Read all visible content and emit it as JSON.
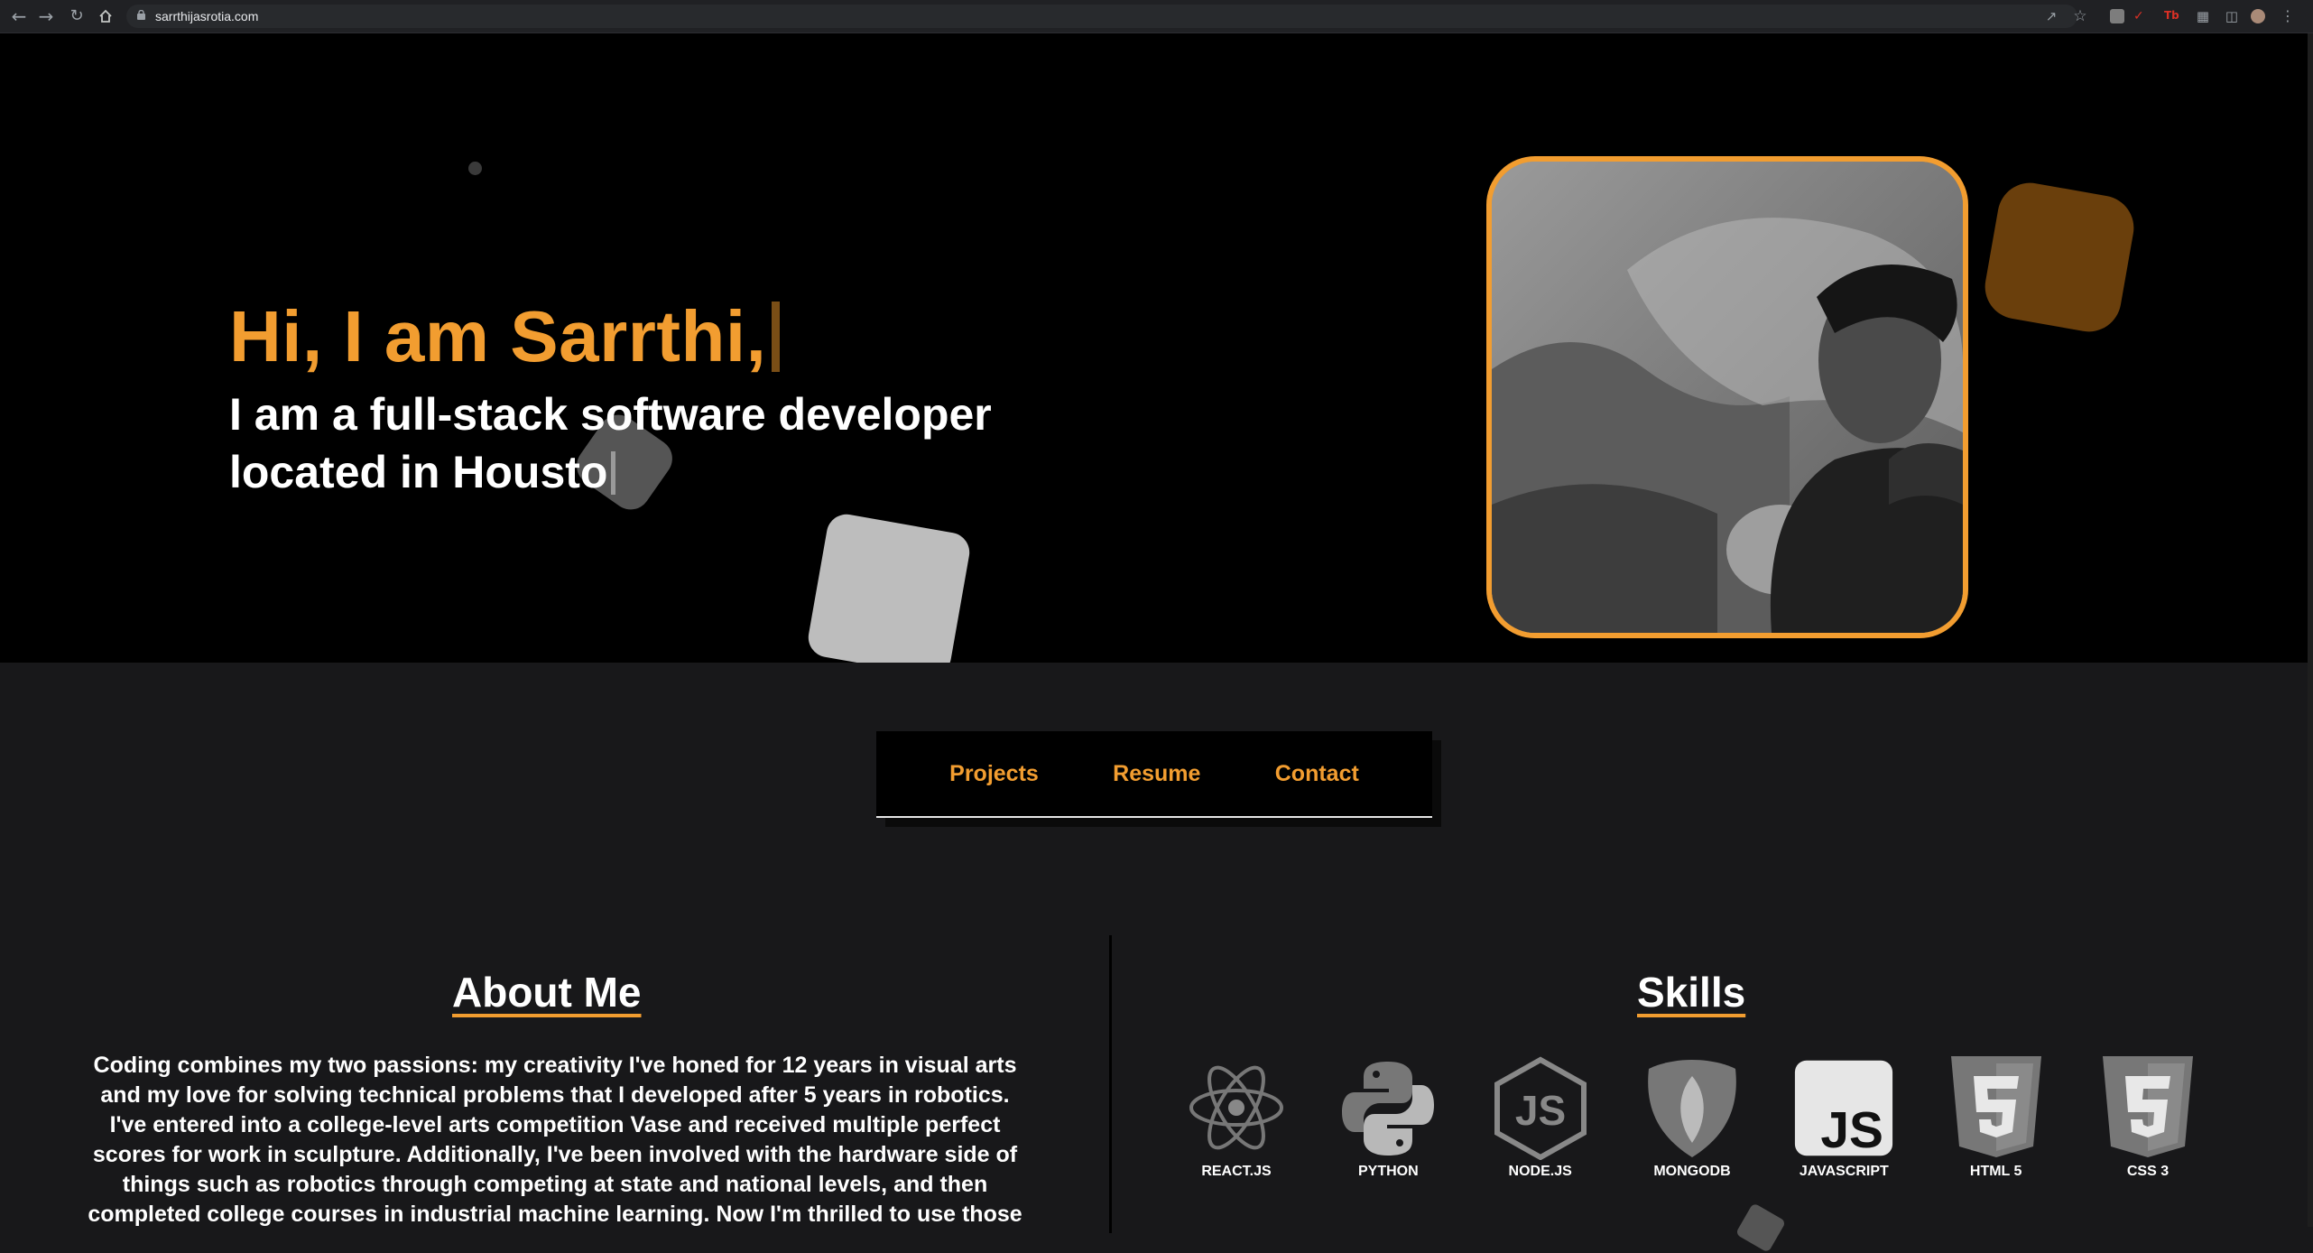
{
  "browser": {
    "url": "sarrthijasrotia.com"
  },
  "hero": {
    "greeting": "Hi, I am Sarrthi,",
    "tagline_line1": "I am a full-stack software developer",
    "tagline_line2": "located in Housto",
    "accent_color": "#f29d30"
  },
  "nav": {
    "items": [
      {
        "label": "Projects"
      },
      {
        "label": "Resume"
      },
      {
        "label": "Contact"
      }
    ]
  },
  "about": {
    "title": "About Me",
    "text": "Coding combines my two passions: my creativity I've honed for 12 years in visual arts and my love for solving technical problems that I developed after 5 years in robotics. I've entered into a college-level arts competition Vase and received multiple perfect scores for work in sculpture. Additionally, I've been involved with the hardware side of things such as robotics through competing at state and national levels, and then completed college courses in industrial machine learning. Now I'm thrilled to use those"
  },
  "skills": {
    "title": "Skills",
    "items": [
      {
        "label": "REACT.JS",
        "icon": "react-icon"
      },
      {
        "label": "PYTHON",
        "icon": "python-icon"
      },
      {
        "label": "NODE.JS",
        "icon": "nodejs-icon"
      },
      {
        "label": "MONGODB",
        "icon": "mongodb-icon"
      },
      {
        "label": "JAVASCRIPT",
        "icon": "javascript-icon"
      },
      {
        "label": "HTML 5",
        "icon": "html5-icon"
      },
      {
        "label": "CSS 3",
        "icon": "css3-icon"
      }
    ]
  }
}
